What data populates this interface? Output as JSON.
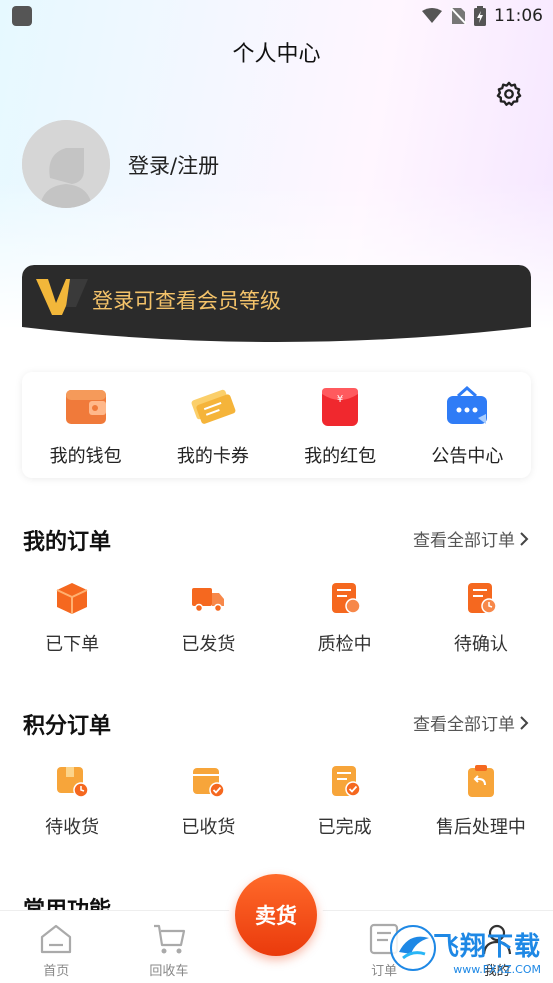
{
  "status_bar": {
    "time": "11:06"
  },
  "header": {
    "title": "个人中心"
  },
  "profile": {
    "login_text": "登录/注册"
  },
  "vip": {
    "text": "登录可查看会员等级"
  },
  "quick_actions": [
    {
      "label": "我的钱包",
      "icon": "wallet-icon"
    },
    {
      "label": "我的卡券",
      "icon": "coupon-icon"
    },
    {
      "label": "我的红包",
      "icon": "red-packet-icon"
    },
    {
      "label": "公告中心",
      "icon": "announcement-icon"
    }
  ],
  "my_orders": {
    "title": "我的订单",
    "more": "查看全部订单",
    "items": [
      {
        "label": "已下单",
        "icon": "box-icon"
      },
      {
        "label": "已发货",
        "icon": "truck-icon"
      },
      {
        "label": "质检中",
        "icon": "inspect-icon"
      },
      {
        "label": "待确认",
        "icon": "pending-icon"
      }
    ]
  },
  "points_orders": {
    "title": "积分订单",
    "more": "查看全部订单",
    "items": [
      {
        "label": "待收货",
        "icon": "await-receive-icon"
      },
      {
        "label": "已收货",
        "icon": "received-icon"
      },
      {
        "label": "已完成",
        "icon": "completed-icon"
      },
      {
        "label": "售后处理中",
        "icon": "after-sale-icon"
      }
    ]
  },
  "common": {
    "title": "常用功能"
  },
  "tabbar": {
    "home": "首页",
    "cart": "回收车",
    "sell": "卖货",
    "orders": "订单",
    "mine": "我的"
  },
  "watermark": {
    "title": "飞翔下载",
    "sub": "www.FXXZ.COM"
  },
  "colors": {
    "accent": "#f15a1f",
    "vip_gold": "#f4c36a",
    "vip_bg": "#2b2b2b"
  }
}
